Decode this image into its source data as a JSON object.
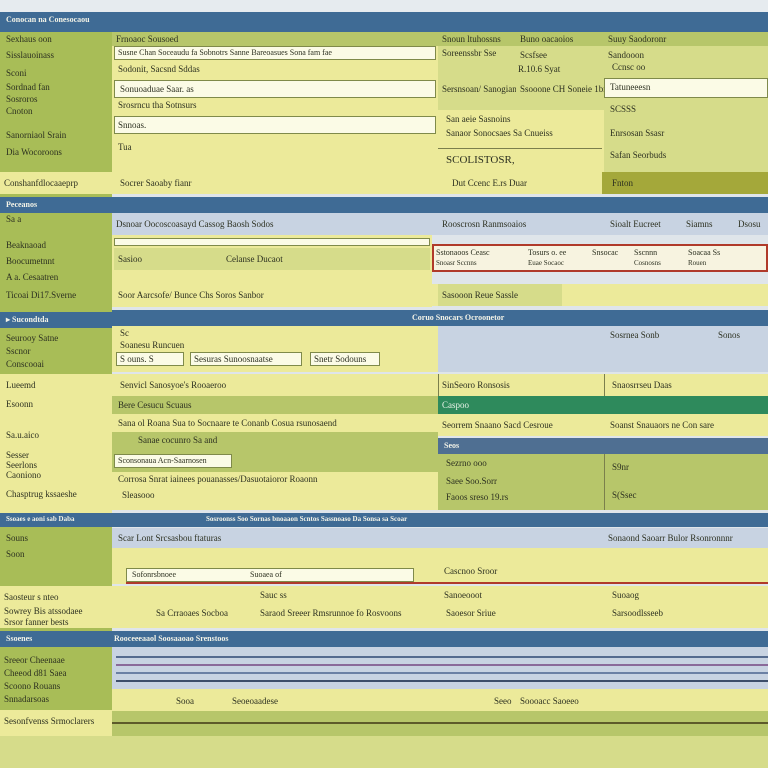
{
  "title": "Conocan na Conesocaou",
  "sidebar": {
    "sec1": [
      "Sexhaus oon",
      "Sisslauoinass",
      "Sconi",
      "Sordnad fan",
      "Sosroros",
      "Cnoton",
      "Sanorniaol Srain",
      "Dia Wocoroons"
    ],
    "sec1_footer": "Conshanfdlocaaeprp",
    "sec2_head": "Peceanos",
    "sec2": [
      "Sa a",
      "Beaknaoad",
      "Boocumetnnt",
      "A a. Cesaatren",
      "Ticoai Di17.Sverne"
    ],
    "sec3_head": "Sucondtda",
    "sec3": [
      "Seurooy Satne",
      "Sscnor",
      "Conscooai"
    ],
    "sec4": [
      "Lueemd",
      "Esoonn",
      "Sa.u.aico",
      "Sesser",
      "Seerlons",
      "Caoniono",
      "Chasptrug kssaeshe"
    ],
    "sec5_head": "Ssoaes e aoni sab Daba",
    "sec5": [
      "Souns",
      "Soon"
    ],
    "sec6": [
      "Saosteur s nteo",
      "Sowrey Bis atssodaee",
      "Srsor fanner bests"
    ],
    "sec7_head": "Ssoenes",
    "sec7": [
      "Sreeor Cheenaae",
      "Cheeod d81 Saea",
      "Scoono Rouans",
      "Snnadarsoas"
    ],
    "sec7_footer": "Sesonfvenss Srmoclarers"
  },
  "panel1": {
    "head": [
      "Frnoaoc Sousoed",
      "Snoun ltuhossns",
      "Buno oacaoios",
      "Suuy Saodoronr"
    ],
    "rows": [
      "Susne Chan Soceaudu fa Sobnotrs Sanne Bareoasues Sona fam fae",
      "Sodonit, Sacsnd Sddas",
      "Sonuoaduae Saar. as",
      "Srosrncu  tha Sotnsurs",
      "Snnoas.",
      "Tua"
    ],
    "col2": [
      "Soreenssbr Sse",
      "Sersnsoan/ Sanogian"
    ],
    "col2b": [
      "San aeie Sasnoins",
      "Sanaor Sonocsaes Sa Cnueiss"
    ],
    "big": "SCOLISTOSR,",
    "col3": [
      "Scsfsee",
      "R.10.6 Syat",
      "Ssooone  CH  Soneie 1bra"
    ],
    "col4": [
      "Sandooon",
      "Ccnsc oo",
      "Tatuneeesn"
    ],
    "col4b": [
      "SCSSS",
      "Enrsosan Ssasr",
      "Safan Seorbuds"
    ],
    "footer": [
      "Socrer Saoaby fianr",
      "Dut Ccenc E.rs Duar",
      "Fnton"
    ]
  },
  "panel2": {
    "head": [
      "Dsnoar Oocoscoasayd Cassog Baosh Sodos",
      "Rooscrosn Ranmsoaios",
      "Sioalt Eucreet",
      "Siamns",
      "Dsosu"
    ],
    "row1": [
      "Sasioo",
      "Celanse Ducaot"
    ],
    "red": [
      "Sstonaoos Ceasc",
      "Snoasr Sccnns",
      "Tosurs o. ee",
      "Euae Socaoc",
      "Snsocac",
      "Sscnnn",
      "Cosnosns",
      "Soacaa Ss",
      "Rouen"
    ],
    "row2": [
      "Soor Aarcsofe/ Bunce Chs Soros Sanbor",
      "Sasooon Reue Sassle"
    ]
  },
  "panel3": {
    "head": "Coruo Snocars Ocroonetor",
    "sub": [
      "Sc",
      "Sosrnea Sonb",
      "Sonos"
    ],
    "rows": [
      "Soanesu Runcuen",
      "Sanae oaosnan Kanonsa",
      "Sotorso Ssuesna"
    ],
    "tabs": [
      "S ouns. S",
      "Sesuras Sunoosnaatse",
      "Snetr Sodouns"
    ],
    "grid": [
      "Senvicl Sanosyoe's Rooaeroo",
      "SinSeoro Ronsosis",
      "Snaosrrseu Daas"
    ]
  },
  "panel4": {
    "rows": [
      "Bere Cesucu Scuaus",
      "Sana ol Roana Sua to Socnaare te Conanb Cosua rsunosaend",
      "Sanae cocunro Sa and",
      "Sconsonaua Acn-Saarnosen",
      "Corrosa Snrat iainees pouanasses/Dasuotaioror Roaonn"
    ],
    "right1": [
      "Seorrem Snaano Sacd Cesroue",
      "Soanst Snauaors ne Con sare"
    ],
    "green_head": "Caspoo",
    "gray_head": "Seos",
    "grid": [
      "Sleasooo",
      "Sezrno ooo",
      "Saee  Soo.Sorr",
      "Faoos sreso 19.rs",
      "S9nr",
      "S(Ssec"
    ]
  },
  "panel5": {
    "head": "Sosroonss Soo Sornas bnoaaon Scntos Sassnoaso Da Sonsa sa Scoar",
    "rows": [
      "Scar Lont Srcsasbou ftaturas",
      "Sofonrsbnoee",
      "Suoaea of",
      "Sarsoodlsseeb"
    ],
    "right": [
      "Cascnoo Sroor",
      "Sonaond Saoarr Bulor Rsonronnnr"
    ],
    "row2": [
      "Sauc ss",
      "Sa Crraoaes Socboa",
      "Saraod Sreeer Rmsrunnoe fo Rosvoons",
      "Saoesor Sriue",
      "Sanoeooot",
      "Suoaog"
    ]
  },
  "panel6": {
    "head": "Rooceeeaaol Soosaaoao Srenstoos",
    "footer": [
      "Sooa",
      "Seoeoaadese",
      "Seeo",
      "Soooacc Saoeeo"
    ]
  }
}
